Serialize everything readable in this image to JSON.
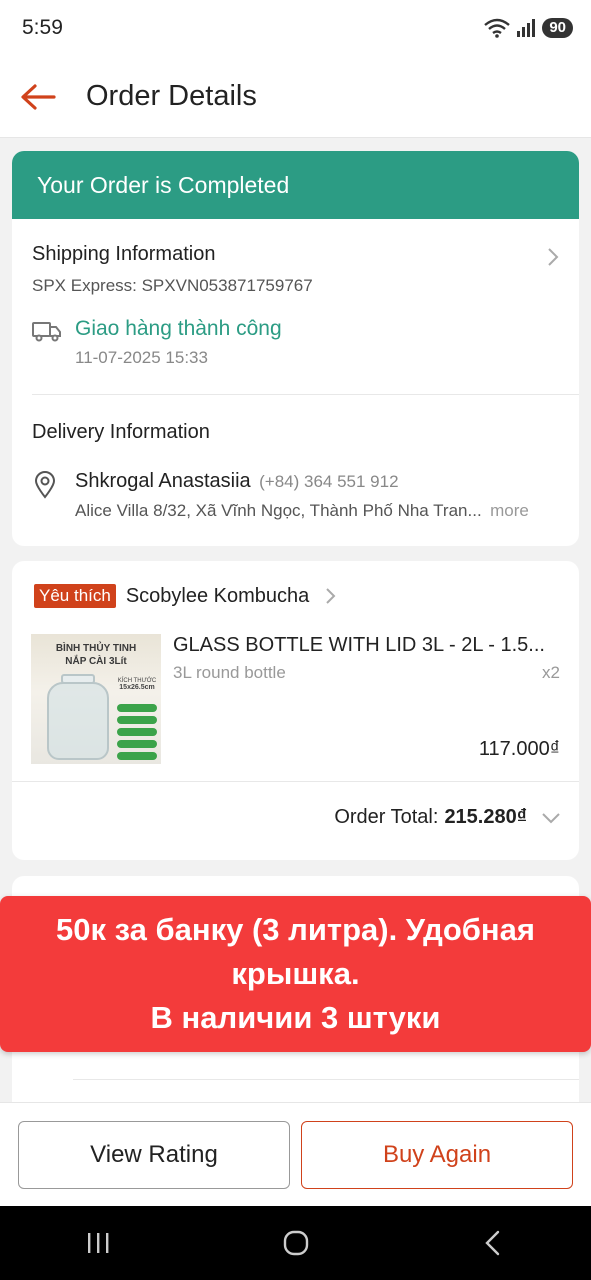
{
  "status_bar": {
    "time": "5:59",
    "battery": "90"
  },
  "header": {
    "title": "Order Details"
  },
  "order": {
    "status_banner": "Your Order is Completed",
    "shipping": {
      "title": "Shipping Information",
      "carrier": "SPX Express: SPXVN053871759767",
      "status": "Giao hàng thành công",
      "timestamp": "11-07-2025 15:33"
    },
    "delivery": {
      "title": "Delivery Information",
      "name": "Shkrogal Anastasiia",
      "phone": "(+84) 364 551 912",
      "address": "Alice Villa 8/32, Xã Vĩnh Ngọc, Thành Phố Nha Tran...",
      "more": "more"
    }
  },
  "shop": {
    "tag": "Yêu thích",
    "name": "Scobylee Kombucha"
  },
  "product": {
    "title": "GLASS BOTTLE WITH LID 3L - 2L - 1.5...",
    "variant": "3L round bottle",
    "quantity": "x2",
    "price": "117.000₫",
    "image_text": {
      "line1": "BÌNH THỦY TINH",
      "line2": "NẮP CÀI 3Lít",
      "size_label": "KÍCH THƯỚC",
      "size": "15x26.5cm"
    }
  },
  "total": {
    "label": "Order Total:",
    "value": "215.280₫"
  },
  "overlay": {
    "line1": "50к за банку (3 литра). Удобная",
    "line2": "крышка.",
    "line3": "В наличии 3 штуки"
  },
  "actions": {
    "view_rating": "View Rating",
    "buy_again": "Buy Again"
  },
  "colors": {
    "accent": "#d0421b",
    "success": "#2c9c84",
    "overlay": "#f33b3b"
  }
}
